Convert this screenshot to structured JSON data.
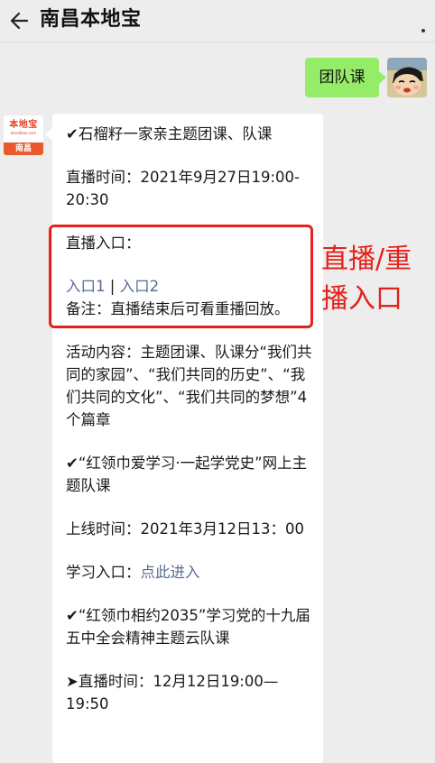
{
  "header": {
    "title": "南昌本地宝",
    "back_icon": "arrow-left-icon",
    "more_icon": "more-dots-icon"
  },
  "outgoing_message": {
    "text": "团队课",
    "bubble_color": "#95ec69"
  },
  "bot_avatar": {
    "logo_text": "本地宝",
    "logo_url": "bendibao.com",
    "city": "南昌"
  },
  "message": {
    "item1_title": "✔石榴籽一家亲主题团课、队课",
    "item1_time": "直播时间：2021年9月27日19:00-20:30",
    "item1_entry_label": "直播入口：",
    "item1_link1": "入口1",
    "item1_separator": " | ",
    "item1_link2": "入口2",
    "item1_note": "备注：直播结束后可看重播回放。",
    "item1_content": "活动内容：主题团课、队课分“我们共同的家园”、“我们共同的历史”、“我们共同的文化”、“我们共同的梦想”4个篇章",
    "item2_title": "✔“红领巾爱学习·一起学党史”网上主题队课",
    "item2_time": "上线时间：2021年3月12日13：00",
    "item2_entry_label": "学习入口：",
    "item2_link": "点此进入",
    "item3_title": "✔“红领巾相约2035”学习党的十九届五中全会精神主题云队课",
    "item3_time": "➤直播时间：12月12日19:00—19:50"
  },
  "annotation": {
    "text": "直播/重播入口",
    "color": "#e5211c"
  },
  "colors": {
    "link": "#576b95",
    "background": "#ededed"
  }
}
